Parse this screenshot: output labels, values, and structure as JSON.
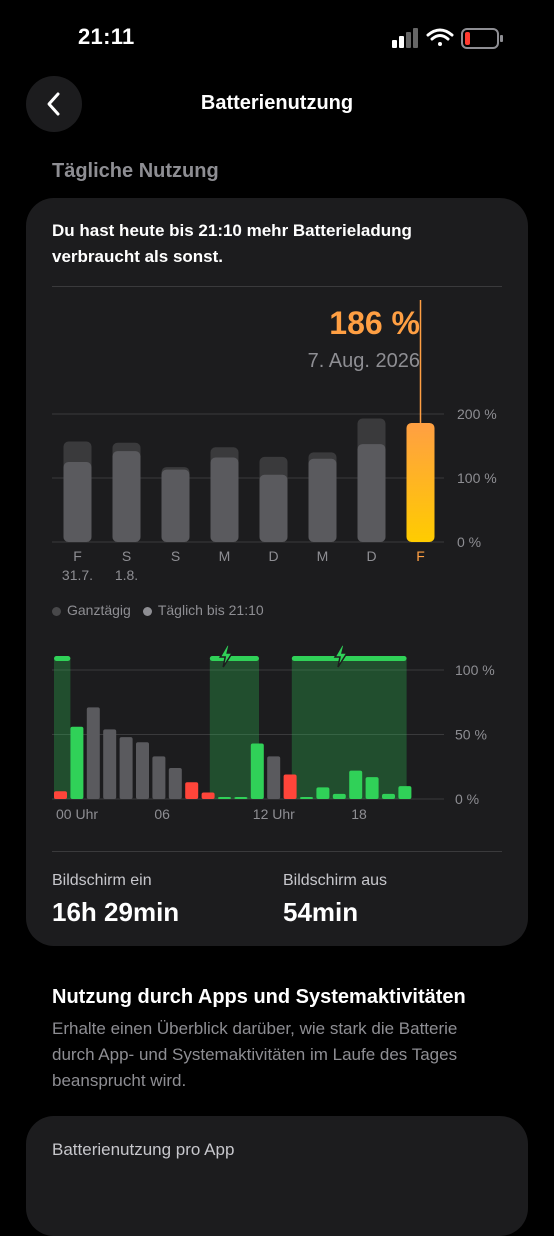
{
  "status_bar": {
    "time": "21:11",
    "icons": [
      "signal-icon",
      "wifi-icon",
      "battery-low-icon"
    ]
  },
  "nav": {
    "title": "Batterienutzung",
    "back_icon": "chevron-left-icon"
  },
  "daily": {
    "section_title": "Tägliche Nutzung",
    "headline": "Du hast heute bis 21:10 mehr Batterieladung verbraucht als sonst.",
    "selected_value": "186 %",
    "selected_date": "7. Aug. 2026",
    "legend": {
      "all_day": "Ganztägig",
      "until": "Täglich bis 21:10"
    }
  },
  "colors": {
    "accent_orange": "#ff9f43",
    "accent_yellow": "#ffcc00",
    "green": "#30d158",
    "red": "#ff453a",
    "bar_gray": "#48484a",
    "bar_dark": "#3a3a3c"
  },
  "chart_data": [
    {
      "type": "bar",
      "categories": [
        "F",
        "S",
        "S",
        "M",
        "D",
        "M",
        "D",
        "F"
      ],
      "sub_labels": [
        "31.7.",
        "1.8.",
        "",
        "",
        "",
        "",
        "",
        ""
      ],
      "series": [
        {
          "name": "Ganztägig",
          "values": [
            157,
            155,
            117,
            148,
            133,
            140,
            193,
            186
          ]
        },
        {
          "name": "Täglich bis 21:10",
          "values": [
            125,
            142,
            113,
            132,
            105,
            130,
            153,
            186
          ]
        }
      ],
      "y_ticks": [
        "0 %",
        "100 %",
        "200 %"
      ],
      "ylim": [
        0,
        200
      ],
      "highlight_index": 7
    },
    {
      "type": "bar",
      "x_ticks": [
        "00 Uhr",
        "06",
        "12 Uhr",
        "18"
      ],
      "y_ticks": [
        "0 %",
        "50 %",
        "100 %"
      ],
      "ylim": [
        0,
        100
      ],
      "hours": [
        0,
        1,
        2,
        3,
        4,
        5,
        6,
        7,
        8,
        9,
        10,
        11,
        12,
        13,
        14,
        15,
        16,
        17,
        18,
        19,
        20,
        21
      ],
      "values": [
        6,
        56,
        71,
        54,
        48,
        44,
        33,
        24,
        13,
        5,
        1,
        1,
        43,
        33,
        19,
        1,
        9,
        4,
        22,
        17,
        4,
        10
      ],
      "states": [
        "red",
        "green",
        "gray",
        "gray",
        "gray",
        "gray",
        "gray",
        "gray",
        "red",
        "red",
        "green",
        "green",
        "green",
        "gray",
        "red",
        "green",
        "green",
        "green",
        "green",
        "green",
        "green",
        "green"
      ],
      "charging_ranges": [
        [
          0,
          1
        ],
        [
          9.5,
          12.5
        ],
        [
          14.5,
          21.5
        ]
      ],
      "charging_icons_at": [
        10.5,
        17.5
      ]
    }
  ],
  "stats": {
    "screen_on_label": "Bildschirm ein",
    "screen_on_value": "16h 29min",
    "screen_off_label": "Bildschirm aus",
    "screen_off_value": "54min"
  },
  "apps": {
    "title": "Nutzung durch Apps und Systemaktivitäten",
    "description": "Erhalte einen Überblick darüber, wie stark die Batterie durch App- und Systemaktivitäten im Laufe des Tages beansprucht wird.",
    "per_app_title": "Batterienutzung pro App"
  }
}
